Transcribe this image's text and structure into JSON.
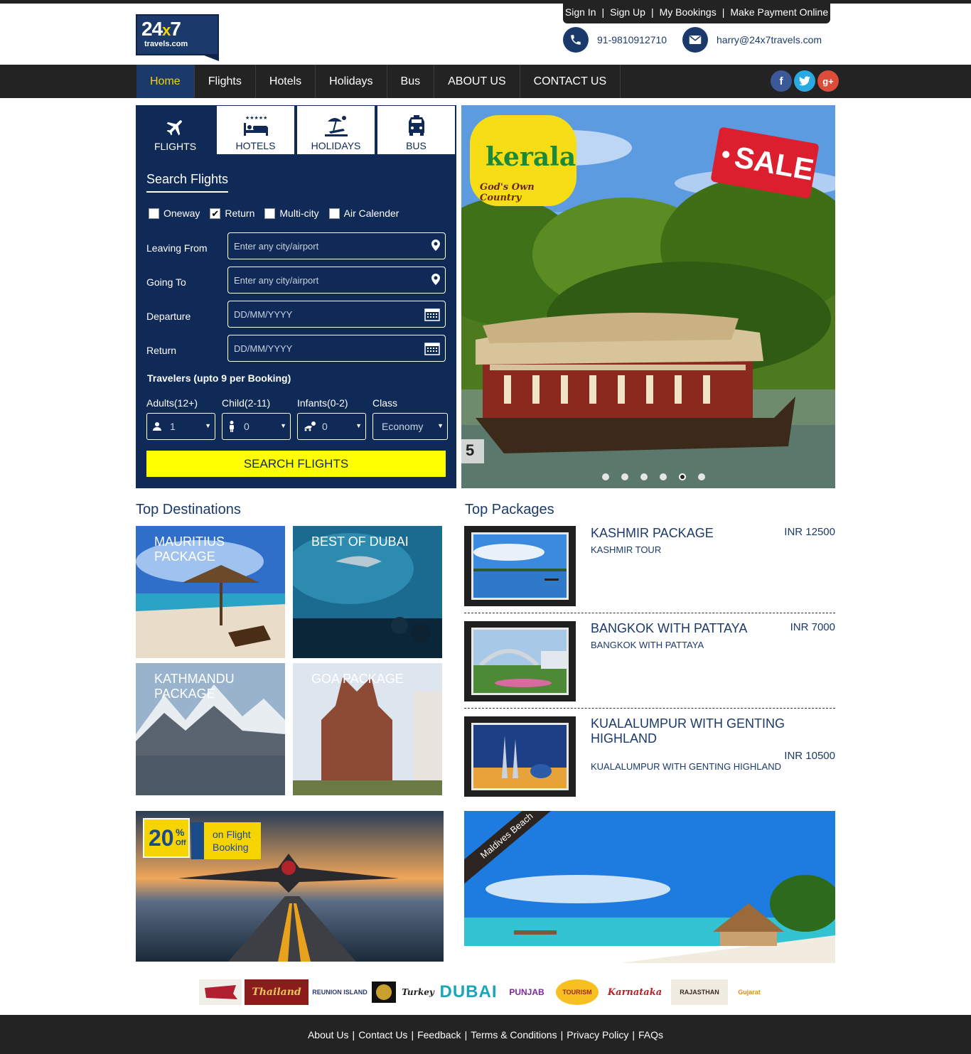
{
  "brand": {
    "logo_main": "24",
    "logo_x": "x",
    "logo_seven": "7",
    "logo_sub": "travels.com"
  },
  "top_links": [
    "Sign In",
    "Sign Up",
    "My Bookings",
    "Make Payment Online"
  ],
  "contact": {
    "phone": "91-9810912710",
    "email": "harry@24x7travels.com"
  },
  "nav": [
    "Home",
    "Flights",
    "Hotels",
    "Holidays",
    "Bus",
    "ABOUT US",
    "CONTACT US"
  ],
  "social": {
    "facebook": "f",
    "twitter": "t",
    "google": "g+"
  },
  "search": {
    "tabs": [
      "FLIGHTS",
      "HOTELS",
      "HOLIDAYS",
      "BUS"
    ],
    "title": "Search Flights",
    "trip_types": [
      {
        "label": "Oneway",
        "checked": false
      },
      {
        "label": "Return",
        "checked": true
      },
      {
        "label": "Multi-city",
        "checked": false
      },
      {
        "label": "Air Calender",
        "checked": false
      }
    ],
    "fields": [
      {
        "label": "Leaving From",
        "placeholder": "Enter any city/airport",
        "icon": "map-marker-icon"
      },
      {
        "label": "Going To",
        "placeholder": "Enter any city/airport",
        "icon": "map-marker-icon"
      },
      {
        "label": "Departure",
        "placeholder": "DD/MM/YYYY",
        "icon": "calendar-icon"
      },
      {
        "label": "Return",
        "placeholder": "DD/MM/YYYY",
        "icon": "calendar-icon"
      }
    ],
    "travelers_title": "Travelers (upto 9 per Booking)",
    "selects": [
      {
        "label": "Adults(12+)",
        "value": "1"
      },
      {
        "label": "Child(2-11)",
        "value": "0"
      },
      {
        "label": "Infants(0-2)",
        "value": "0"
      },
      {
        "label": "Class",
        "value": "Economy"
      }
    ],
    "button": "SEARCH FLIGHTS"
  },
  "banner": {
    "kerala": "kerala",
    "tagline": "God's Own Country",
    "sale": "SALE",
    "slide_number": "5",
    "slides": 6,
    "active_slide": 5
  },
  "top_destinations": {
    "title": "Top Destinations",
    "items": [
      "MAURITIUS PACKAGE",
      "BEST OF DUBAI",
      "KATHMANDU PACKAGE",
      "GOA PACKAGE"
    ]
  },
  "top_packages": {
    "title": "Top Packages",
    "items": [
      {
        "name": "KASHMIR PACKAGE",
        "sub": "KASHMIR TOUR",
        "price": "INR 12500"
      },
      {
        "name": "BANGKOK WITH PATTAYA",
        "sub": "BANGKOK WITH PATTAYA",
        "price": "INR 7000"
      },
      {
        "name": "KUALALUMPUR WITH GENTING HIGHLAND",
        "sub": "KUALALUMPUR WITH GENTING HIGHLAND",
        "price": "INR 10500"
      }
    ]
  },
  "promo_flight": {
    "percent": "20",
    "pct_sign": "%",
    "off": "Off",
    "line1": "on Flight",
    "line2": "Booking"
  },
  "promo_beach": {
    "ribbon": "Maldives Beach"
  },
  "partners": [
    "Thailand",
    "REUNION ISLAND",
    "Turkey",
    "DUBAI",
    "PUNJAB",
    "TOURISM",
    "Karnataka",
    "RAJASTHAN",
    "Gujarat"
  ],
  "footer": [
    "About Us",
    "Contact Us",
    "Feedback",
    "Terms & Conditions",
    "Privacy Policy",
    "FAQs"
  ]
}
